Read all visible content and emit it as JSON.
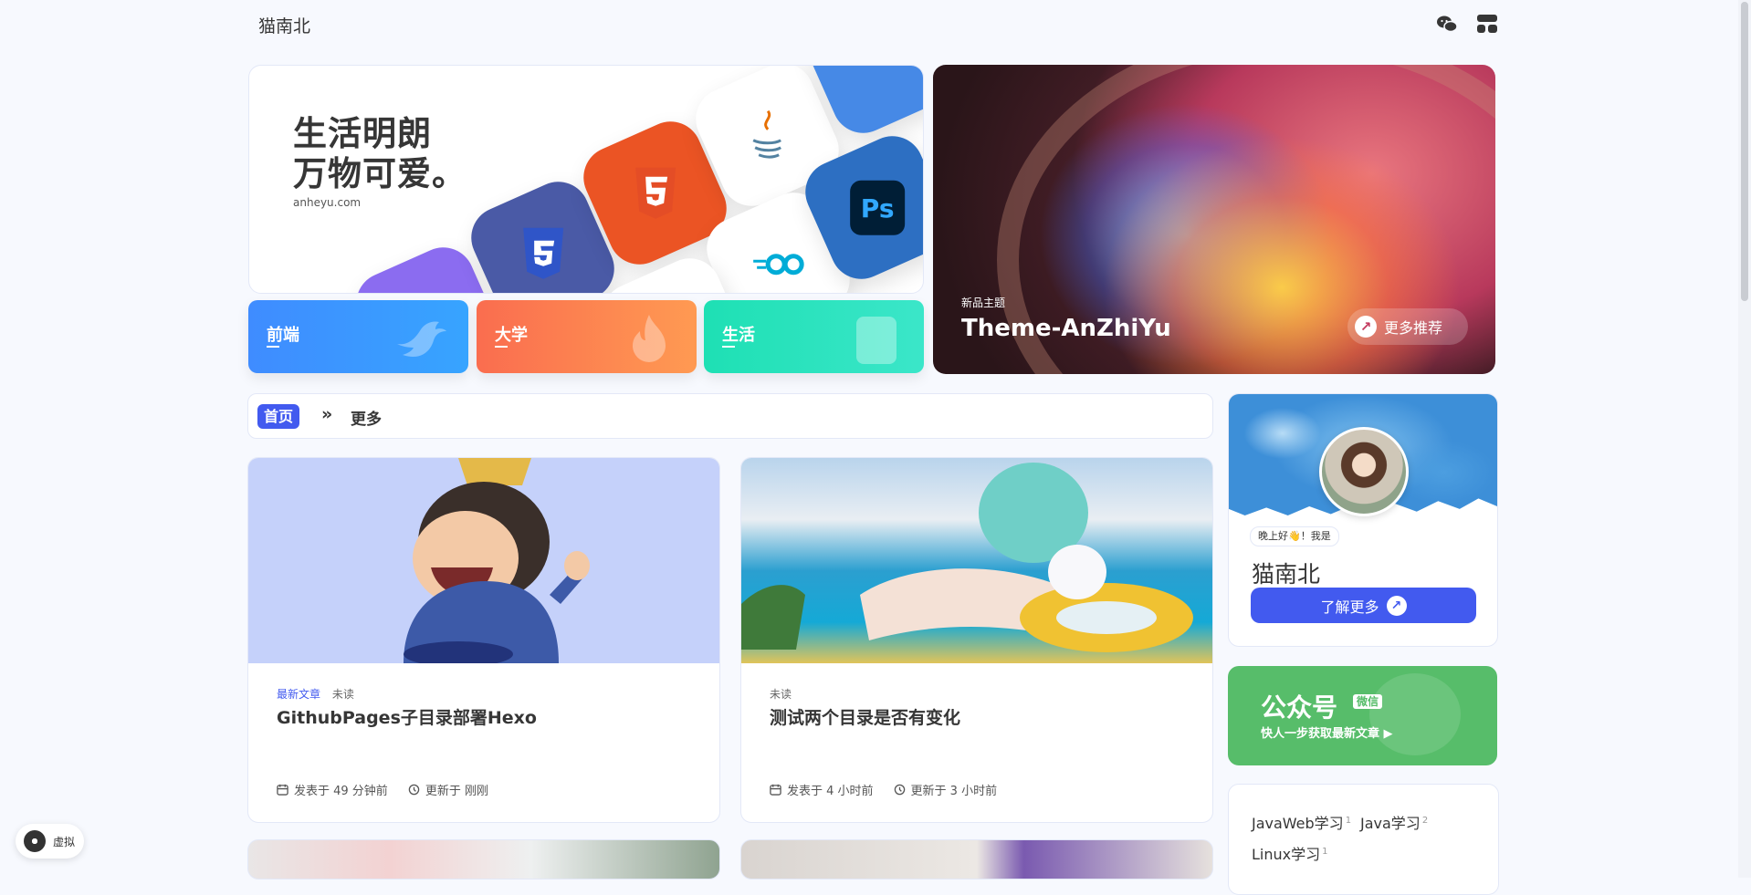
{
  "header": {
    "site_title": "猫南北",
    "icons": [
      "wechat-icon",
      "random-post-icon"
    ]
  },
  "hero": {
    "slogan_line1": "生活明朗",
    "slogan_line2": "万物可爱。",
    "site_url": "anheyu.com",
    "categories": [
      {
        "label": "前端",
        "color": "#3f8cff"
      },
      {
        "label": "大学",
        "color": "#fb7d4e"
      },
      {
        "label": "生活",
        "color": "#29e0b8"
      }
    ]
  },
  "featured": {
    "tag": "新品主题",
    "title": "Theme-AnZhiYu",
    "more_label": "更多推荐"
  },
  "breadcrumb": {
    "home": "首页",
    "more": "更多"
  },
  "posts": [
    {
      "tag_new": "最新文章",
      "tag_unread": "未读",
      "title": "GithubPages子目录部署Hexo",
      "published": "发表于 49 分钟前",
      "updated": "更新于 刚刚"
    },
    {
      "tag_new": "",
      "tag_unread": "未读",
      "title": "测试两个目录是否有变化",
      "published": "发表于 4 小时前",
      "updated": "更新于 3 小时前"
    }
  ],
  "author": {
    "greeting": "晚上好👋！我是",
    "name": "猫南北",
    "button": "了解更多"
  },
  "wechat": {
    "title": "公众号",
    "badge": "微信",
    "subtitle": "快人一步获取最新文章 ▶"
  },
  "tags": [
    {
      "name": "JavaWeb学习",
      "count": "1"
    },
    {
      "name": "Java学习",
      "count": "2"
    },
    {
      "name": "Linux学习",
      "count": "1"
    }
  ],
  "player": {
    "label": "虚拟"
  },
  "colors": {
    "accent": "#425aef",
    "background": "#f7f9fe",
    "wechat_green": "#57bd6a"
  }
}
